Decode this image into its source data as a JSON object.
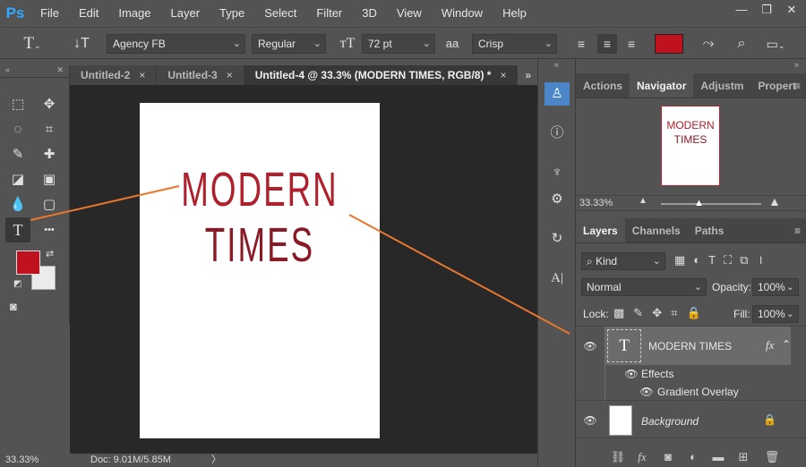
{
  "app": {
    "logo": "Ps"
  },
  "menu": [
    "File",
    "Edit",
    "Image",
    "Layer",
    "Type",
    "Select",
    "Filter",
    "3D",
    "View",
    "Window",
    "Help"
  ],
  "window_controls": {
    "minimize": "—",
    "restore": "❐",
    "close": "✕"
  },
  "options_bar": {
    "font_family": "Agency FB",
    "font_style": "Regular",
    "font_size": "72 pt",
    "aa_label": "aa",
    "antialias": "Crisp",
    "text_color": "#c0111f"
  },
  "doc_tabs": [
    {
      "label": "Untitled-2",
      "close": "×"
    },
    {
      "label": "Untitled-3",
      "close": "×"
    },
    {
      "label": "Untitled-4 @ 33.3% (MODERN TIMES, RGB/8) *",
      "close": "×"
    }
  ],
  "doc_tabs_more": "»",
  "artboard_text": {
    "line1": "MODERN",
    "line2": "TIMES"
  },
  "tool_panel": {
    "collapse": "«",
    "close": "✕",
    "foreground_color": "#c0111f",
    "background_color": "#ebebeb",
    "more_tools": "•••"
  },
  "status_bar": {
    "zoom": "33.33%",
    "doc": "Doc: 9.01M/5.85M",
    "arrow": "〉"
  },
  "navigator_panel": {
    "tabs": [
      "Actions",
      "Navigator",
      "Adjustm",
      "Propert"
    ],
    "active_tab": "Navigator",
    "thumb_line1": "MODERN",
    "thumb_line2": "TIMES",
    "zoom": "33.33%"
  },
  "layers_panel": {
    "tabs": [
      "Layers",
      "Channels",
      "Paths"
    ],
    "active_tab": "Layers",
    "filter_kind": "Kind",
    "blend_mode": "Normal",
    "opacity_label": "Opacity:",
    "opacity_value": "100%",
    "lock_label": "Lock:",
    "fill_label": "Fill:",
    "fill_value": "100%",
    "layers": [
      {
        "name": "MODERN TIMES",
        "type": "text",
        "fx": "fx"
      },
      {
        "name": "Background",
        "type": "background"
      }
    ],
    "effects_label": "Effects",
    "effect_item": "Gradient Overlay",
    "thumb_text_glyph": "T"
  },
  "panel_collapse": "«",
  "panel_expand": "»",
  "arrow_color": "#e8772e"
}
